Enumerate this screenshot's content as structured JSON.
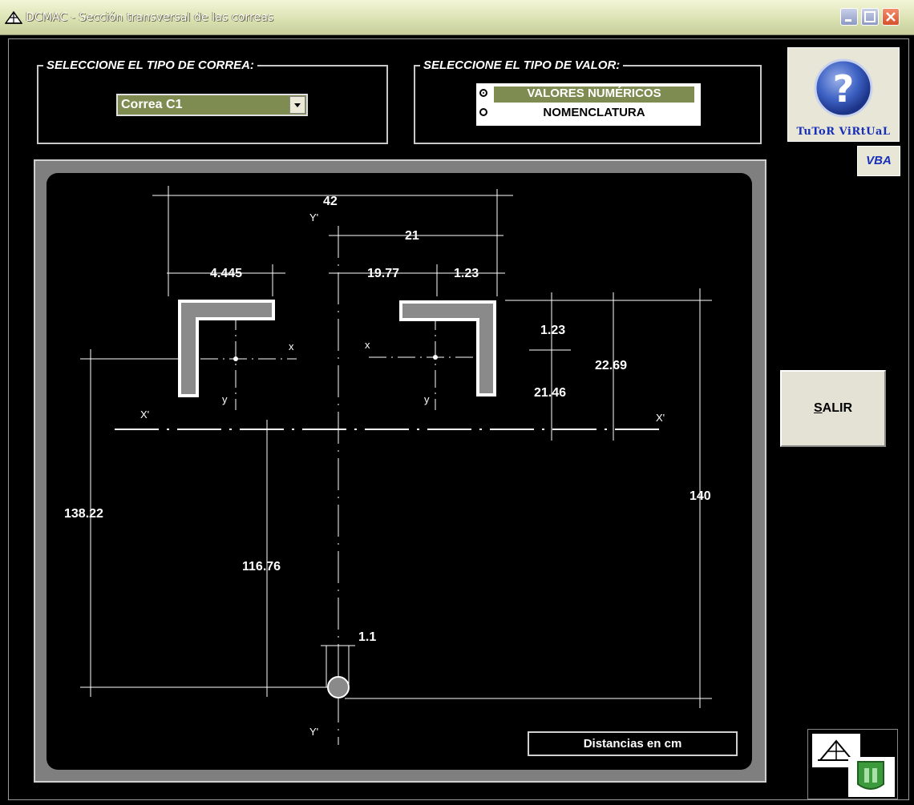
{
  "window": {
    "title": "DCMAC - Sección transversal de las correas"
  },
  "correa_group": {
    "legend": "SELECCIONE EL TIPO DE CORREA:",
    "selected": "Correa C1"
  },
  "valor_group": {
    "legend": "SELECCIONE EL TIPO DE VALOR:",
    "options": [
      {
        "label": "VALORES NUMÉRICOS",
        "selected": true
      },
      {
        "label": "NOMENCLATURA",
        "selected": false
      }
    ]
  },
  "help": {
    "label": "TuToR ViRtUaL",
    "icon": "question-mark-icon"
  },
  "vba": {
    "label": "VBA"
  },
  "salir": {
    "label_first": "S",
    "label_rest": "ALIR"
  },
  "drawing": {
    "units_note": "Distancias en cm",
    "dims": {
      "total_width": "42",
      "half_width": "21",
      "flange": "4.445",
      "inner": "19.77",
      "thickness": "1.23",
      "thickness_v": "1.23",
      "centroid_height": "22.69",
      "web_to_axis": "21.46",
      "total_height": "140",
      "left_height": "138.22",
      "center_height": "116.76",
      "pin": "1.1"
    },
    "axes": {
      "x": "x",
      "y": "y",
      "X_prime": "X'",
      "Y_prime": "Y'"
    }
  },
  "colors": {
    "accent": "#7e8c52",
    "link": "#1830b8",
    "profile_fill": "#8a8a8a"
  }
}
